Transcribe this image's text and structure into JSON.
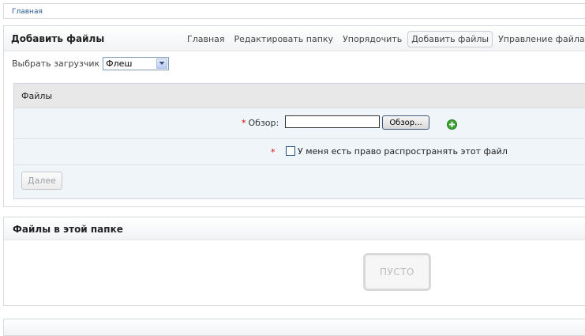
{
  "breadcrumb": {
    "home": "Главная"
  },
  "main_panel": {
    "title": "Добавить файлы",
    "tabs": [
      {
        "label": "Главная",
        "active": false
      },
      {
        "label": "Редактировать папку",
        "active": false
      },
      {
        "label": "Упорядочить",
        "active": false
      },
      {
        "label": "Добавить файлы",
        "active": true
      },
      {
        "label": "Управление файлами",
        "active": false
      }
    ],
    "uploader": {
      "label": "Выбрать загрузчик",
      "selected": "Флеш"
    }
  },
  "files_section": {
    "title": "Файлы",
    "browse_label": "Обзор:",
    "required_mark": "*",
    "browse_input_value": "",
    "browse_button": "Обзор...",
    "rights_label": "У меня есть право распространять этот файл",
    "rights_checked": false,
    "next_button": "Далее"
  },
  "folder_panel": {
    "title": "Файлы в этой папке",
    "empty_label": "ПУСТО"
  },
  "colors": {
    "link": "#2a5a94",
    "required": "#dd0000",
    "add_icon": "#3fa233"
  }
}
